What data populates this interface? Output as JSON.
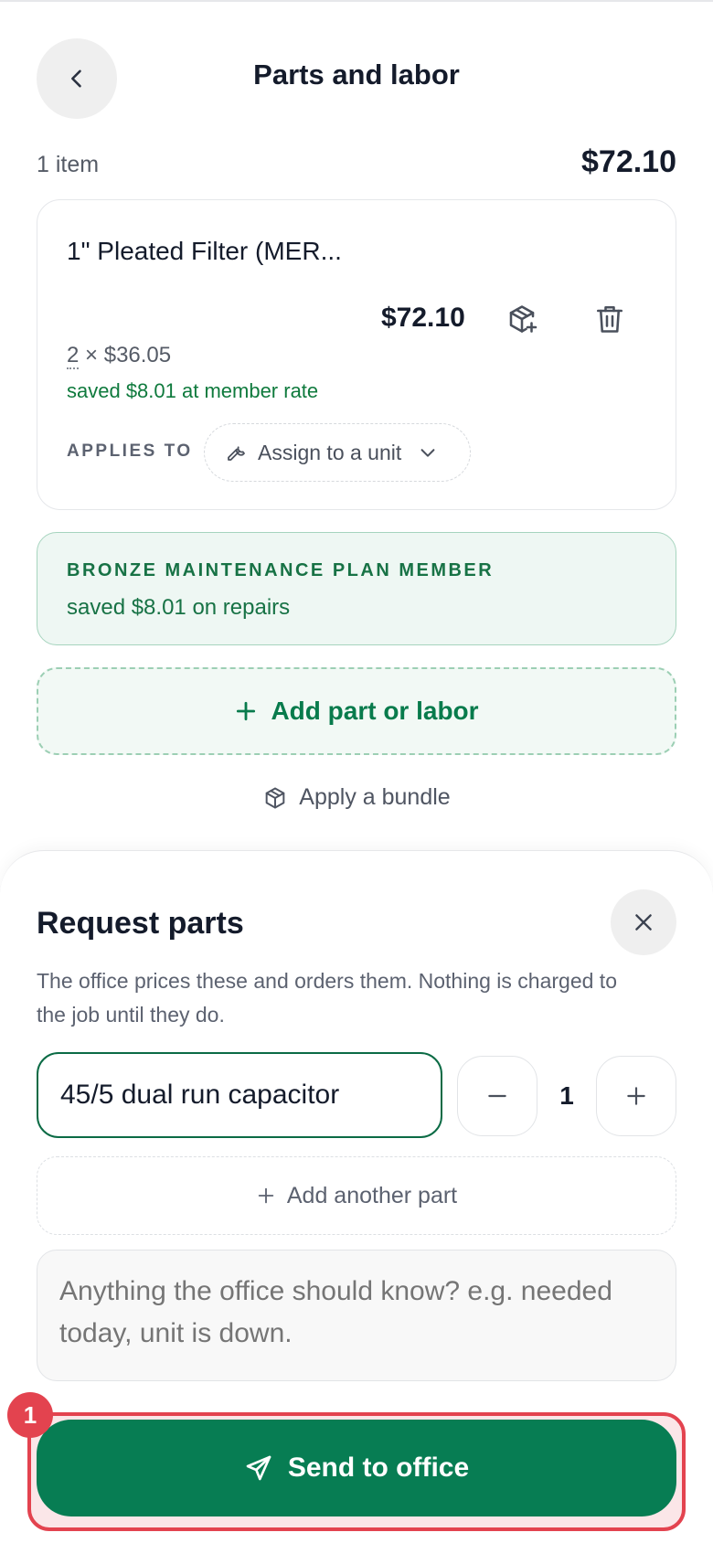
{
  "header": {
    "title": "Parts and labor",
    "back_icon": "chevron-left-icon"
  },
  "summary": {
    "item_count": "1 item",
    "total": "$72.10"
  },
  "line_item": {
    "name": "1\" Pleated Filter (MER...",
    "price": "$72.10",
    "quantity": "2",
    "unit_price": "× $36.05",
    "saved_text": "saved $8.01 at member rate",
    "applies_to_label": "APPLIES TO",
    "assign_label": "Assign to a unit",
    "icons": [
      "package-plus-icon",
      "trash-icon",
      "wrench-icon",
      "chevron-down-icon"
    ]
  },
  "member_banner": {
    "title": "BRONZE MAINTENANCE PLAN MEMBER",
    "saved_text": "saved $8.01 on repairs"
  },
  "actions": {
    "add_part_label": "Add part or labor",
    "apply_bundle_label": "Apply a bundle"
  },
  "request_sheet": {
    "title": "Request parts",
    "description": "The office prices these and orders them. Nothing is charged to the job until they do.",
    "part_value": "45/5 dual run capacitor",
    "quantity": "1",
    "add_another_label": "Add another part",
    "notes_placeholder": "Anything the office should know? e.g. needed today, unit is down.",
    "send_label": "Send to office",
    "badge": "1"
  },
  "colors": {
    "brand_green": "#077d53",
    "highlight_red": "#e3434f",
    "saved_green": "#0f7a3d"
  }
}
